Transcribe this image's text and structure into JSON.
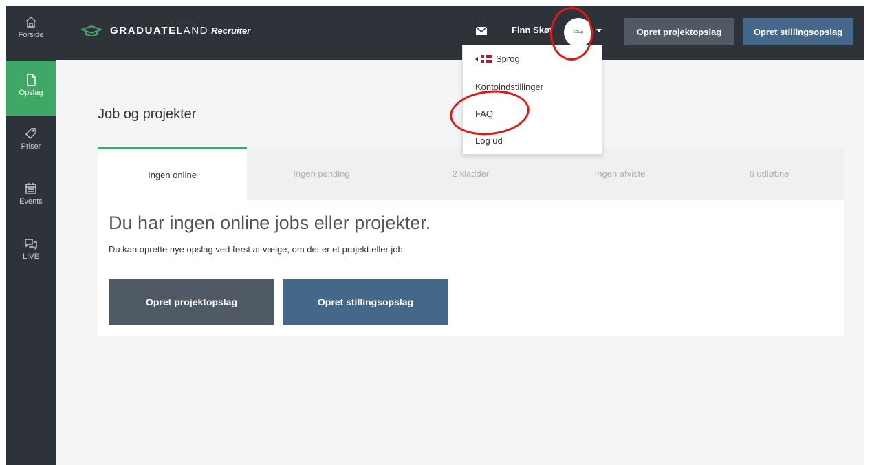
{
  "app": {
    "brand": "GRADUATE",
    "brand_light": "LAND",
    "recruiter": "Recruiter"
  },
  "sidebar": {
    "items": [
      {
        "label": "Forside",
        "icon": "home-icon"
      },
      {
        "label": "Opslag",
        "icon": "document-icon",
        "active": true
      },
      {
        "label": "Priser",
        "icon": "tag-icon"
      },
      {
        "label": "Events",
        "icon": "calendar-icon"
      },
      {
        "label": "LIVE",
        "icon": "chat-bubbles-icon"
      }
    ]
  },
  "header": {
    "username": "Finn Skøt",
    "avatar_text": "SDU◉",
    "create_project_label": "Opret projektopslag",
    "create_job_label": "Opret stillingsopslag"
  },
  "dropdown": {
    "language_label": "Sprog",
    "account_settings": "Kontoindstillinger",
    "faq": "FAQ",
    "logout": "Log ud"
  },
  "main": {
    "title": "Job og projekter",
    "tabs": [
      {
        "label": "Ingen online",
        "active": true
      },
      {
        "label": "Ingen pending"
      },
      {
        "label": "2 kladder"
      },
      {
        "label": "Ingen afviste"
      },
      {
        "label": "6 udløbne"
      }
    ],
    "empty_title": "Du har ingen online jobs eller projekter.",
    "empty_description": "Du kan oprette nye opslag ved først at vælge, om det er et projekt eller job.",
    "create_project_label": "Opret projektopslag",
    "create_job_label": "Opret stillingsopslag"
  },
  "colors": {
    "sidebar_bg": "#2d3339",
    "accent_green": "#3fa866",
    "project_button": "#4f5a64",
    "job_button": "#456789",
    "annotation": "#e01818"
  }
}
